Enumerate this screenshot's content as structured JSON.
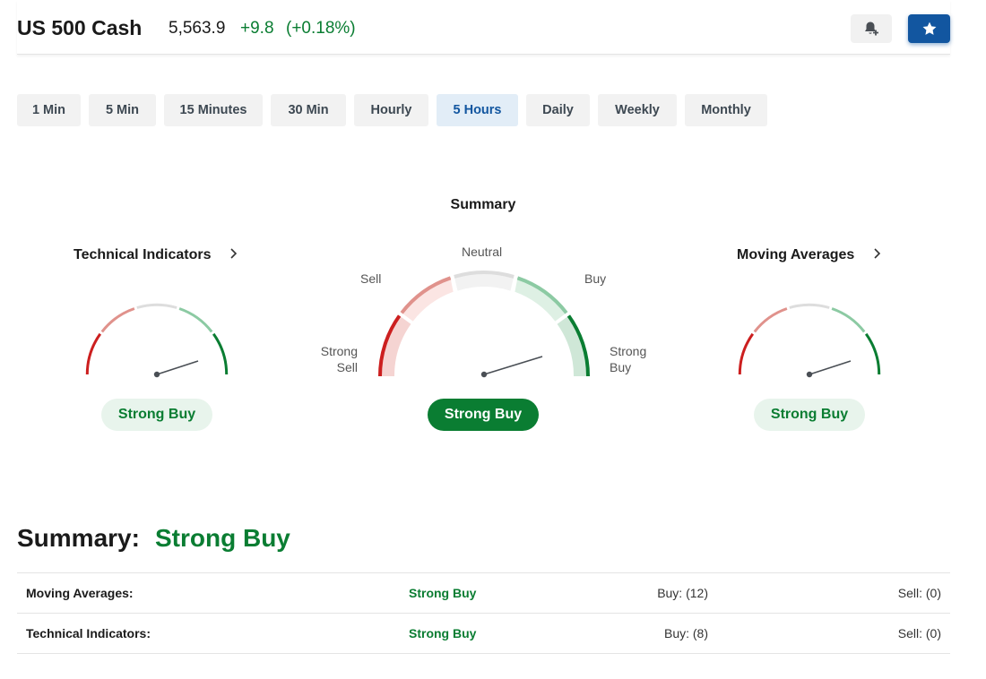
{
  "header": {
    "title": "US 500 Cash",
    "price": "5,563.9",
    "change": "+9.8",
    "change_pct": "(+0.18%)",
    "alert_icon": "bell-plus-icon",
    "watchlist_icon": "star-icon"
  },
  "tabs": [
    {
      "label": "1 Min",
      "active": false
    },
    {
      "label": "5 Min",
      "active": false
    },
    {
      "label": "15 Minutes",
      "active": false
    },
    {
      "label": "30 Min",
      "active": false
    },
    {
      "label": "Hourly",
      "active": false
    },
    {
      "label": "5 Hours",
      "active": true
    },
    {
      "label": "Daily",
      "active": false
    },
    {
      "label": "Weekly",
      "active": false
    },
    {
      "label": "Monthly",
      "active": false
    }
  ],
  "gauges": {
    "technical": {
      "title": "Technical Indicators",
      "result": "Strong Buy"
    },
    "summary": {
      "title": "Summary",
      "result": "Strong Buy",
      "labels": {
        "strong_sell": "Strong\nSell",
        "sell": "Sell",
        "neutral": "Neutral",
        "buy": "Buy",
        "strong_buy": "Strong\nBuy"
      }
    },
    "moving": {
      "title": "Moving Averages",
      "result": "Strong Buy"
    }
  },
  "summary": {
    "heading": "Summary:",
    "value": "Strong Buy",
    "rows": [
      {
        "label": "Moving Averages:",
        "value": "Strong Buy",
        "buy": "Buy: (12)",
        "sell": "Sell: (0)"
      },
      {
        "label": "Technical Indicators:",
        "value": "Strong Buy",
        "buy": "Buy: (8)",
        "sell": "Sell: (0)"
      }
    ]
  },
  "colors": {
    "buy_green": "#0a7d32",
    "brand_blue": "#1256a0",
    "sell_red": "#cc1f1f"
  }
}
